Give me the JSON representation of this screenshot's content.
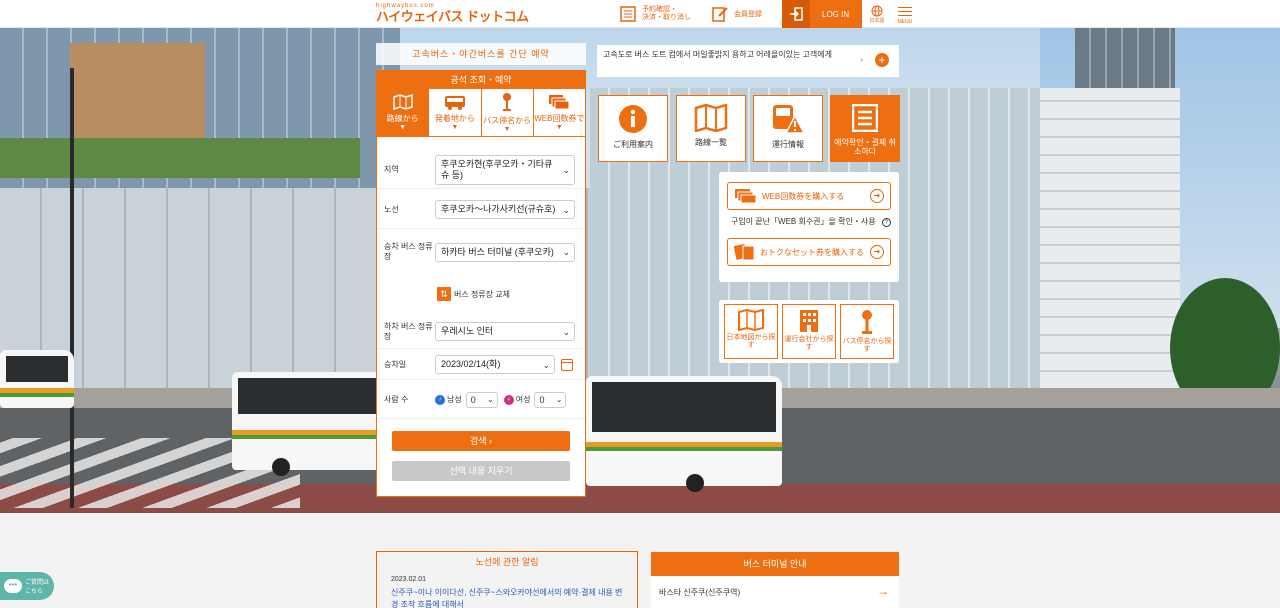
{
  "header": {
    "logo_sub": "highwaybus.com",
    "logo_main": "ハイウェイバス ドットコム",
    "confirm_line1": "予約確認・",
    "confirm_line2": "決済・取り消し",
    "member": "会員登録",
    "login": "LOG IN",
    "lang": "日本語",
    "menu": "MENU"
  },
  "search": {
    "banner": "고속버스・야간버스를 간단 예약",
    "title": "공석 조회・예약",
    "tabs": [
      {
        "label": "路線から",
        "icon": "map-icon"
      },
      {
        "label": "発着地から",
        "icon": "bus-icon"
      },
      {
        "label": "バス停名から",
        "icon": "bus-stop-icon"
      },
      {
        "label": "WEB回数券で",
        "icon": "ticket-icon"
      }
    ],
    "region_label": "지역",
    "region_value": "후쿠오카현(후쿠오카・기타큐슈 등)",
    "route_label": "노선",
    "route_value": "후쿠오카～나가사키선(규슈호)",
    "board_label": "승차 버스 정류장",
    "board_value": "하카타 버스 터미널 (후쿠오카)",
    "swap_label": "버스 정류장 교체",
    "alight_label": "하차 버스 정류장",
    "alight_value": "우레시노 인터",
    "date_label": "승차일",
    "date_value": "2023/02/14(화)",
    "people_label": "사람 수",
    "male_label": "남성",
    "male_value": "0",
    "female_label": "여성",
    "female_value": "0",
    "search_button": "검색",
    "clear_button": "선택 내용 지우기"
  },
  "info_bar": {
    "text": "고속도로 버스 도트 컴에서 머일좋밝지 용하고 어레을이있는 고객에게",
    "arrow": "›",
    "plus": "+"
  },
  "tiles": [
    {
      "label": "ご利用案内",
      "icon": "info-icon"
    },
    {
      "label": "路線一覧",
      "icon": "map-icon"
    },
    {
      "label": "運行情報",
      "icon": "bus-warning-icon"
    },
    {
      "label": "예약확인・결제 취소하다",
      "icon": "list-icon"
    }
  ],
  "tickets": {
    "buy_web": "WEB回数券を購入する",
    "note": "구입이 끝난「WEB 회수권」을 확인・사용",
    "buy_set": "おトクなセット券を購入する"
  },
  "small_tiles": [
    {
      "label": "日本地図から探す",
      "icon": "map-icon"
    },
    {
      "label": "運行会社から探す",
      "icon": "building-icon"
    },
    {
      "label": "バス停名から探す",
      "icon": "bus-stop-icon"
    }
  ],
  "news": {
    "title": "노선에 관한 알림",
    "date": "2023.02.01",
    "text": "신주쿠~이나 이이다선, 신주쿠~스와오카야선에서의 예약·결제 내용 변경 조작 흐름에 대해서"
  },
  "terminal": {
    "title": "버스 터미널 안내",
    "item": "바스타 신주쿠(신주쿠역)",
    "arrow": "→"
  },
  "helper": {
    "text_line1": "ご質問は",
    "text_line2": "こちら"
  },
  "colors": {
    "accent": "#ee6f12",
    "accent_dark": "#d75a05",
    "link": "#2b56b8",
    "helper": "#5fb5a9"
  }
}
